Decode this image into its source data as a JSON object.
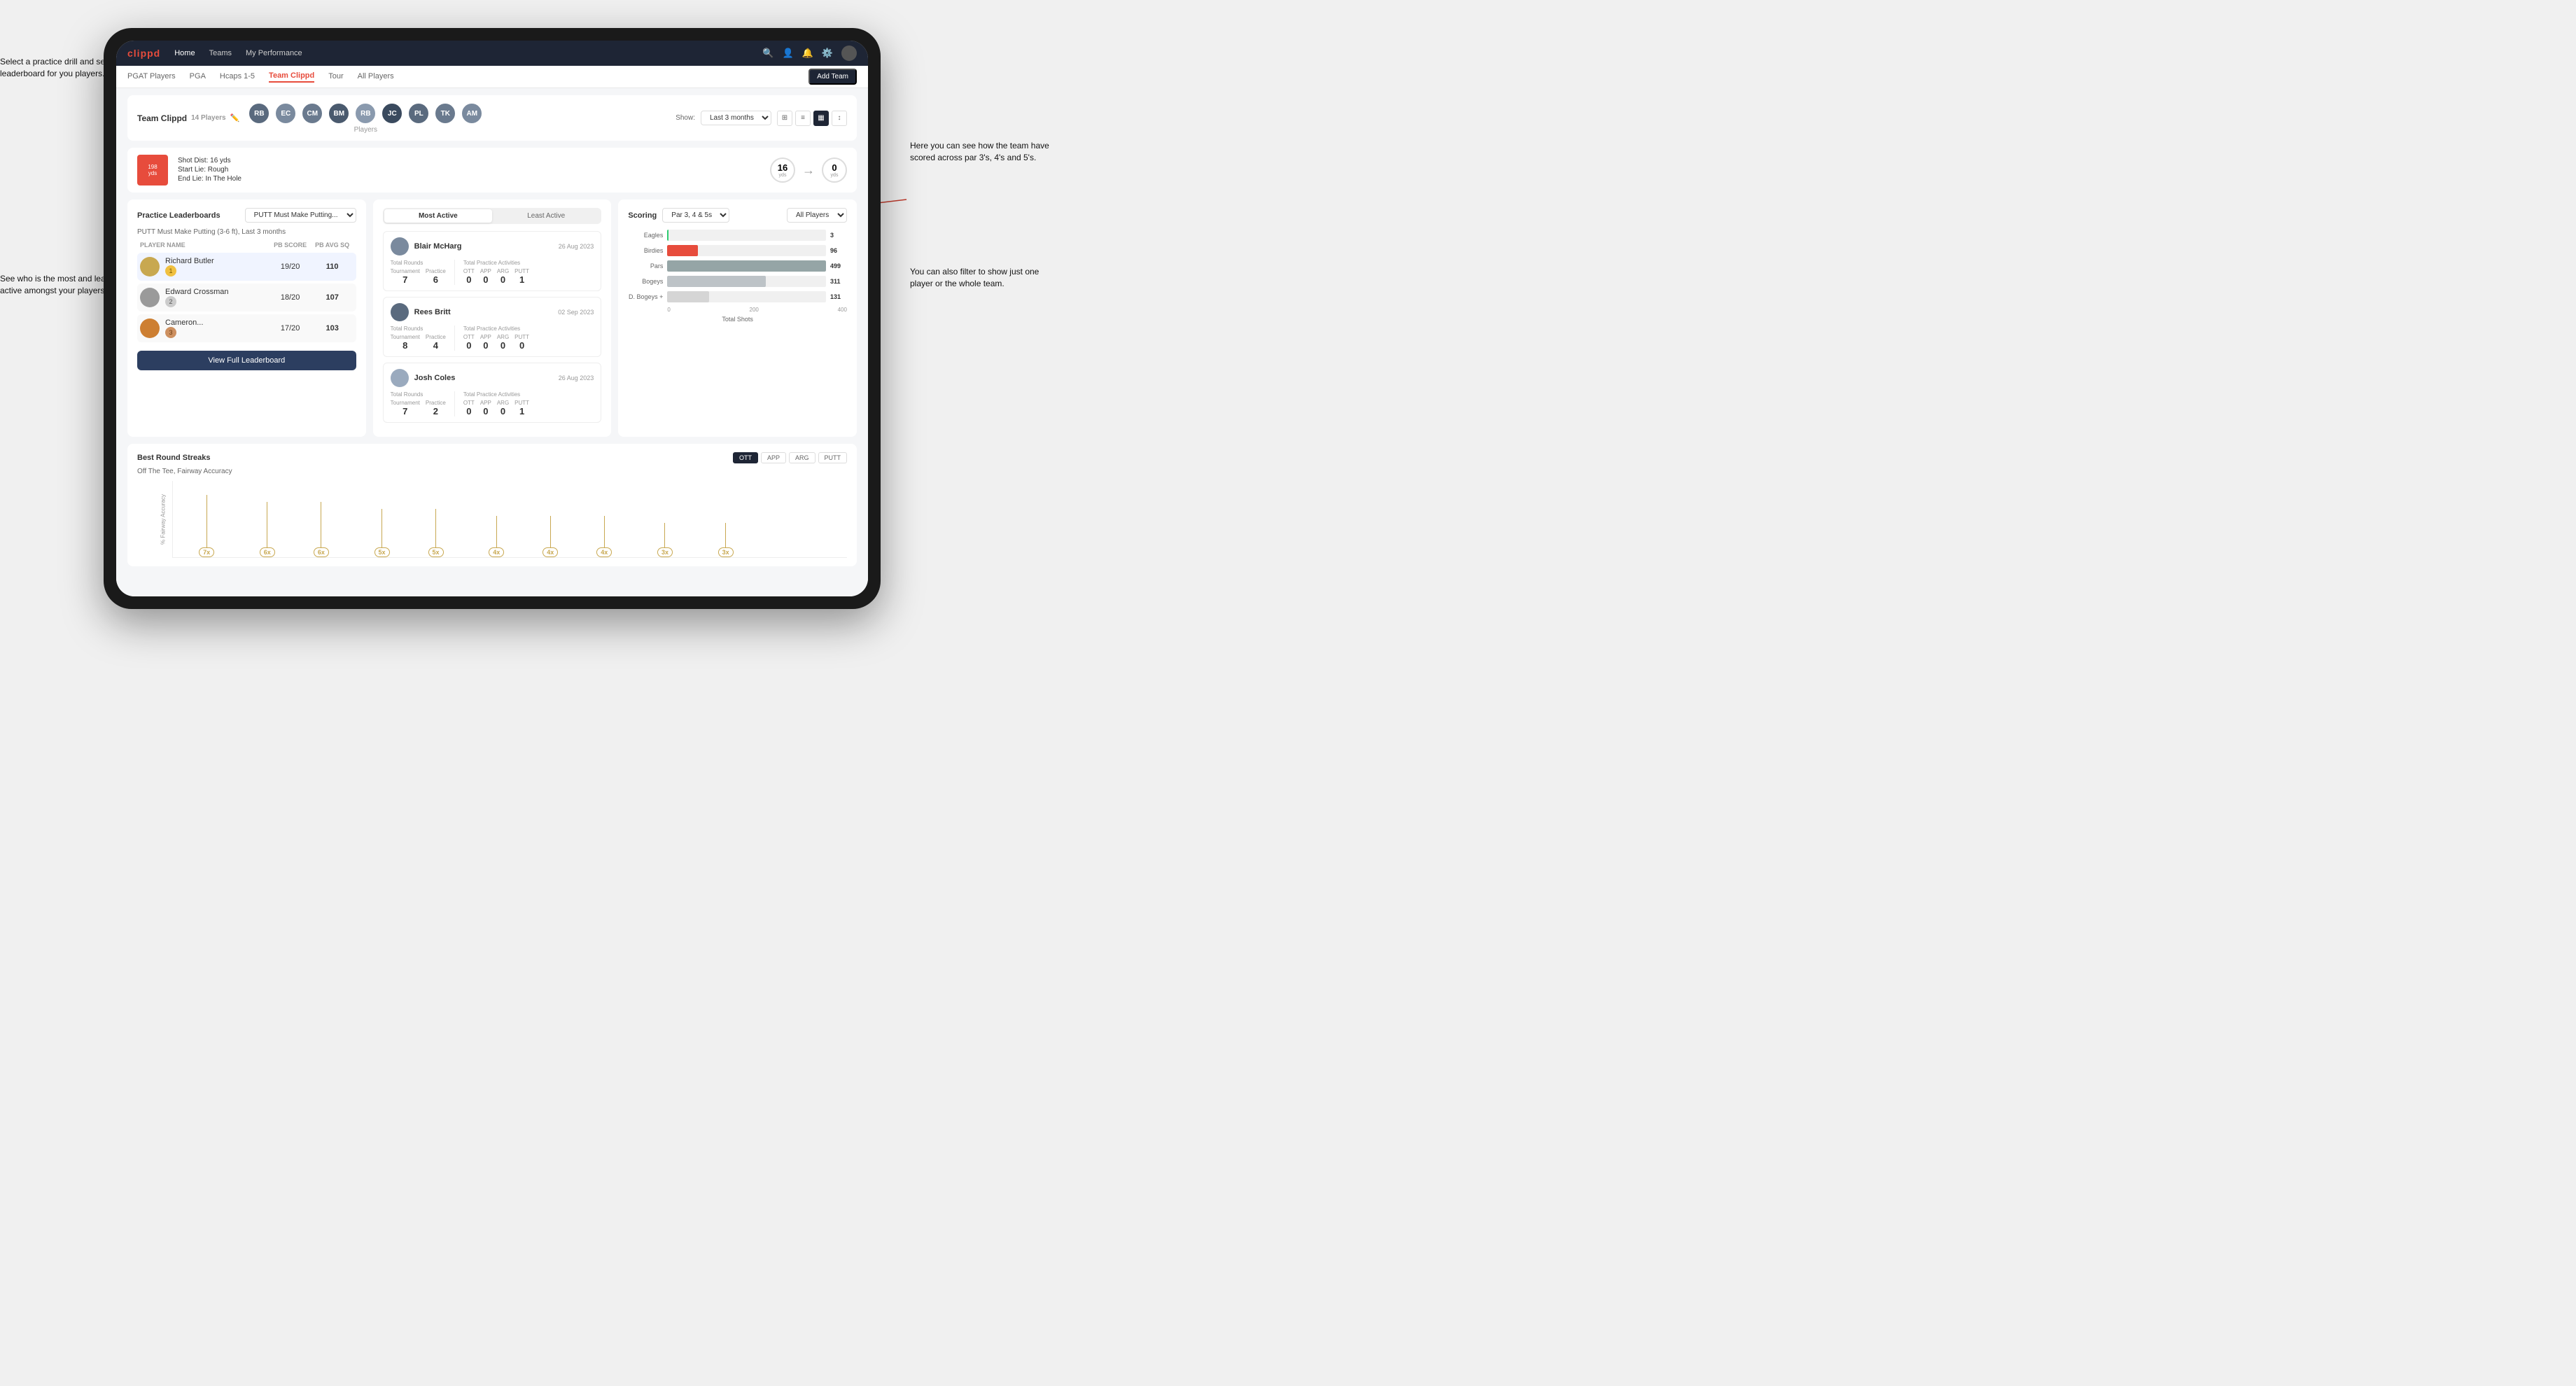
{
  "annotations": {
    "ann1": "Select a practice drill and see the leaderboard for you players.",
    "ann2": "See who is the most and least active amongst your players.",
    "ann3": "Here you can see how the team have scored across par 3's, 4's and 5's.",
    "ann4": "You can also filter to show just one player or the whole team."
  },
  "nav": {
    "logo": "clippd",
    "items": [
      "Home",
      "Teams",
      "My Performance"
    ],
    "icons": [
      "🔍",
      "👤",
      "🔔",
      "⚙️"
    ]
  },
  "subnav": {
    "items": [
      "PGAT Players",
      "PGA",
      "Hcaps 1-5",
      "Team Clippd",
      "Tour",
      "All Players"
    ],
    "active": "Team Clippd",
    "add_team": "Add Team"
  },
  "team": {
    "title": "Team Clippd",
    "count": "14 Players",
    "show_label": "Show:",
    "show_value": "Last 3 months",
    "players_label": "Players"
  },
  "shot_info": {
    "dist": "198",
    "unit": "yds",
    "dist_label": "Shot Dist: 16 yds",
    "start_lie": "Start Lie: Rough",
    "end_lie": "End Lie: In The Hole",
    "metric1_val": "16",
    "metric1_unit": "yds",
    "metric2_val": "0",
    "metric2_unit": "yds"
  },
  "leaderboard": {
    "title": "Practice Leaderboards",
    "drill": "PUTT Must Make Putting...",
    "subtitle": "PUTT Must Make Putting (3-6 ft), Last 3 months",
    "cols": [
      "PLAYER NAME",
      "PB SCORE",
      "PB AVG SQ"
    ],
    "rows": [
      {
        "name": "Richard Butler",
        "rank": "1",
        "score": "19/20",
        "avg": "110",
        "medal": "gold"
      },
      {
        "name": "Edward Crossman",
        "rank": "2",
        "score": "18/20",
        "avg": "107",
        "medal": "silver"
      },
      {
        "name": "Cameron...",
        "rank": "3",
        "score": "17/20",
        "avg": "103",
        "medal": "bronze"
      }
    ],
    "view_full": "View Full Leaderboard"
  },
  "activity": {
    "tabs": [
      "Most Active",
      "Least Active"
    ],
    "active_tab": "Most Active",
    "players": [
      {
        "name": "Blair McHarg",
        "date": "26 Aug 2023",
        "total_rounds_label": "Total Rounds",
        "tournament": "7",
        "practice": "6",
        "total_practice_label": "Total Practice Activities",
        "ott": "0",
        "app": "0",
        "arg": "0",
        "putt": "1"
      },
      {
        "name": "Rees Britt",
        "date": "02 Sep 2023",
        "total_rounds_label": "Total Rounds",
        "tournament": "8",
        "practice": "4",
        "total_practice_label": "Total Practice Activities",
        "ott": "0",
        "app": "0",
        "arg": "0",
        "putt": "0"
      },
      {
        "name": "Josh Coles",
        "date": "26 Aug 2023",
        "total_rounds_label": "Total Rounds",
        "tournament": "7",
        "practice": "2",
        "total_practice_label": "Total Practice Activities",
        "ott": "0",
        "app": "0",
        "arg": "0",
        "putt": "1"
      }
    ]
  },
  "scoring": {
    "title": "Scoring",
    "filter1": "Par 3, 4 & 5s",
    "filter2": "All Players",
    "bars": [
      {
        "label": "Eagles",
        "value": 3,
        "max": 500,
        "color": "#2ecc71"
      },
      {
        "label": "Birdies",
        "value": 96,
        "max": 500,
        "color": "#e74c3c"
      },
      {
        "label": "Pars",
        "value": 499,
        "max": 500,
        "color": "#95a5a6"
      },
      {
        "label": "Bogeys",
        "value": 311,
        "max": 500,
        "color": "#f39c12"
      },
      {
        "label": "D. Bogeys +",
        "value": 131,
        "max": 500,
        "color": "#e67e22"
      }
    ],
    "x_axis": [
      "0",
      "200",
      "400"
    ],
    "x_label": "Total Shots"
  },
  "streaks": {
    "title": "Best Round Streaks",
    "buttons": [
      "OTT",
      "APP",
      "ARG",
      "PUTT"
    ],
    "active_btn": "OTT",
    "subtitle": "Off The Tee, Fairway Accuracy",
    "points": [
      {
        "x": 5,
        "y": 85,
        "label": "7x",
        "line_h": 70
      },
      {
        "x": 13,
        "y": 75,
        "label": "6x",
        "line_h": 60
      },
      {
        "x": 21,
        "y": 75,
        "label": "6x",
        "line_h": 60
      },
      {
        "x": 30,
        "y": 65,
        "label": "5x",
        "line_h": 50
      },
      {
        "x": 38,
        "y": 65,
        "label": "5x",
        "line_h": 50
      },
      {
        "x": 47,
        "y": 55,
        "label": "4x",
        "line_h": 40
      },
      {
        "x": 54,
        "y": 55,
        "label": "4x",
        "line_h": 40
      },
      {
        "x": 62,
        "y": 55,
        "label": "4x",
        "line_h": 40
      },
      {
        "x": 71,
        "y": 45,
        "label": "3x",
        "line_h": 30
      },
      {
        "x": 79,
        "y": 45,
        "label": "3x",
        "line_h": 30
      }
    ]
  }
}
